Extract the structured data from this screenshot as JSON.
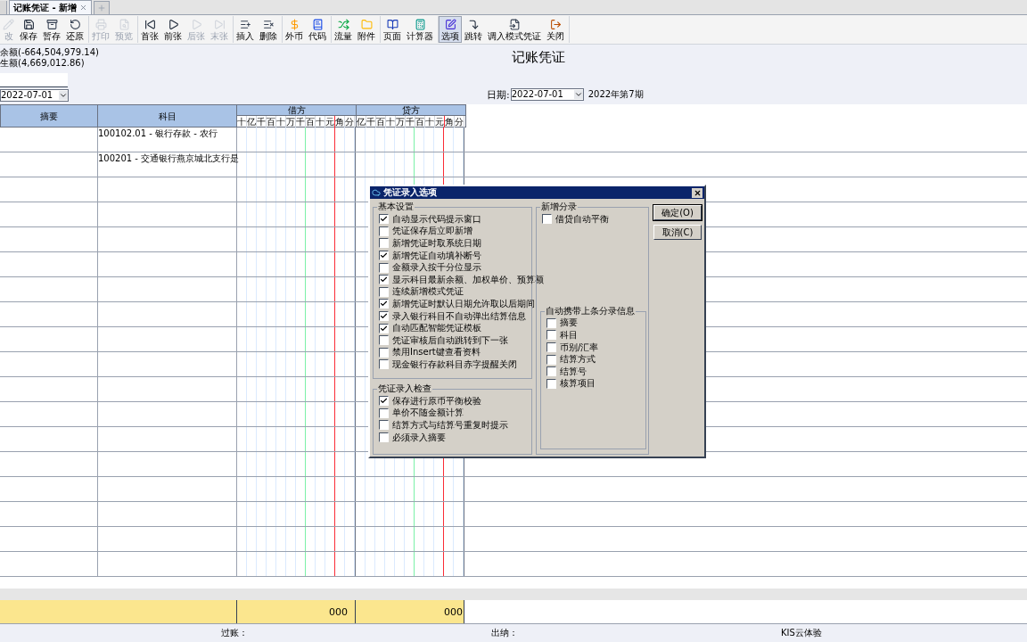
{
  "tabs": [
    {
      "label": "记账凭证 - 新增",
      "selected": true
    }
  ],
  "toolbar": [
    {
      "items": [
        {
          "label": "改",
          "disabled": true,
          "selected": false
        },
        {
          "label": "保存",
          "disabled": false,
          "selected": false
        },
        {
          "label": "暂存",
          "disabled": false,
          "selected": false
        },
        {
          "label": "还原",
          "disabled": false,
          "selected": false
        }
      ]
    },
    {
      "items": [
        {
          "label": "打印",
          "disabled": true,
          "selected": false
        },
        {
          "label": "预览",
          "disabled": true,
          "selected": false
        }
      ]
    },
    {
      "items": [
        {
          "label": "首张",
          "disabled": false,
          "selected": false
        },
        {
          "label": "前张",
          "disabled": false,
          "selected": false
        },
        {
          "label": "后张",
          "disabled": true,
          "selected": false
        },
        {
          "label": "末张",
          "disabled": true,
          "selected": false
        }
      ]
    },
    {
      "items": [
        {
          "label": "插入",
          "disabled": false,
          "selected": false
        },
        {
          "label": "删除",
          "disabled": false,
          "selected": false
        }
      ]
    },
    {
      "items": [
        {
          "label": "外币",
          "disabled": false,
          "selected": false
        },
        {
          "label": "代码",
          "disabled": false,
          "selected": false
        }
      ]
    },
    {
      "items": [
        {
          "label": "流量",
          "disabled": false,
          "selected": false
        },
        {
          "label": "附件",
          "disabled": false,
          "selected": false
        }
      ]
    },
    {
      "items": [
        {
          "label": "页面",
          "disabled": false,
          "selected": false
        },
        {
          "label": "计算器",
          "disabled": false,
          "selected": false
        }
      ]
    },
    {
      "items": [
        {
          "label": "选项",
          "disabled": false,
          "selected": true
        },
        {
          "label": "跳转",
          "disabled": false,
          "selected": false
        },
        {
          "label": "调入模式凭证",
          "disabled": false,
          "selected": false
        },
        {
          "label": "关闭",
          "disabled": false,
          "selected": false
        }
      ]
    }
  ],
  "summary": [
    "余额(-664,504,979.14)",
    "生额(4,669,012.86)"
  ],
  "title": "记账凭证",
  "left_date": "2022-07-01",
  "date_label": "日期:",
  "date": "2022-07-01",
  "period": "2022年第7期",
  "table": {
    "columns": [
      "摘要",
      "科目"
    ],
    "debit": {
      "label": "借方",
      "digits": [
        "十",
        "亿",
        "千",
        "百",
        "十",
        "万",
        "千",
        "百",
        "十",
        "元",
        "角",
        "分"
      ]
    },
    "credit": {
      "label": "贷方",
      "digits": [
        "亿",
        "千",
        "百",
        "十",
        "万",
        "千",
        "百",
        "十",
        "元",
        "角",
        "分"
      ]
    },
    "rows": [
      {
        "account": "100102.01 - 银行存款 - 农行"
      },
      {
        "account": "100201 - 交通银行燕京城北支行是"
      }
    ]
  },
  "totals": {
    "debit": "000",
    "credit": "000"
  },
  "status_bar": [
    "过账：",
    "出纳：",
    "KIS云体验"
  ],
  "dialog": {
    "title": "凭证录入选项",
    "groups": [
      {
        "title": "基本设置",
        "items": [
          {
            "label": "自动显示代码提示窗口",
            "checked": true
          },
          {
            "label": "凭证保存后立即新增",
            "checked": false
          },
          {
            "label": "新增凭证时取系统日期",
            "checked": false
          },
          {
            "label": "新增凭证自动填补断号",
            "checked": true
          },
          {
            "label": "金额录入按千分位显示",
            "checked": false
          },
          {
            "label": "显示科目最新余额、加权单价、预算额",
            "checked": true
          },
          {
            "label": "连续新增模式凭证",
            "checked": false
          },
          {
            "label": "新增凭证时默认日期允许取以后期间",
            "checked": true
          },
          {
            "label": "录入银行科目不自动弹出结算信息",
            "checked": true
          },
          {
            "label": "自动匹配智能凭证模板",
            "checked": true
          },
          {
            "label": "凭证审核后自动跳转到下一张",
            "checked": false
          },
          {
            "label": "禁用Insert键查看资料",
            "checked": false
          },
          {
            "label": "现金银行存款科目赤字提醒关闭",
            "checked": false
          }
        ]
      },
      {
        "title": "凭证录入检查",
        "items": [
          {
            "label": "保存进行原币平衡校验",
            "checked": true
          },
          {
            "label": "单价不随金额计算",
            "checked": false
          },
          {
            "label": "结算方式与结算号重复时提示",
            "checked": false
          },
          {
            "label": "必须录入摘要",
            "checked": false
          }
        ]
      },
      {
        "title": "新增分录",
        "items": [
          {
            "label": "借贷自动平衡",
            "checked": false
          }
        ]
      },
      {
        "title": "自动携带上条分录信息",
        "items": [
          {
            "label": "摘要",
            "checked": false
          },
          {
            "label": "科目",
            "checked": false
          },
          {
            "label": "币别/汇率",
            "checked": false
          },
          {
            "label": "结算方式",
            "checked": false
          },
          {
            "label": "结算号",
            "checked": false
          },
          {
            "label": "核算项目",
            "checked": false
          }
        ]
      }
    ],
    "buttons": [
      "确定(O)",
      "取消(C)"
    ]
  }
}
